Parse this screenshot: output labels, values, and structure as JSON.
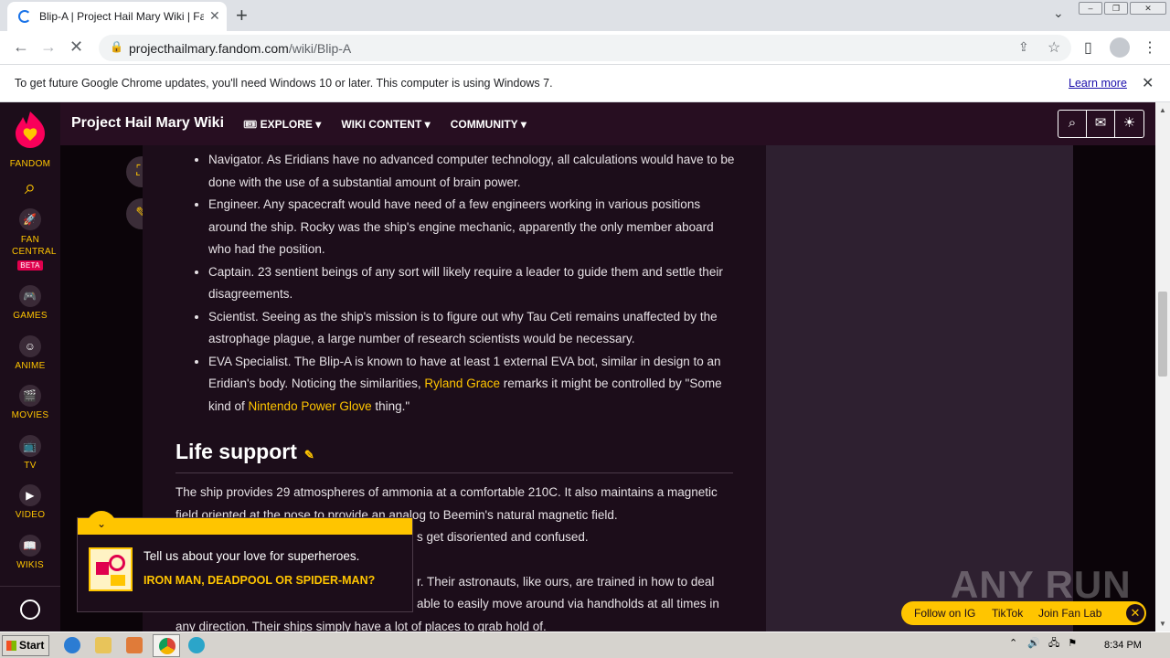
{
  "browser": {
    "tab_title": "Blip-A | Project Hail Mary Wiki | Fandom",
    "url_domain": "projecthailmary.fandom.com",
    "url_path": "/wiki/Blip-A"
  },
  "infobar": {
    "message": "To get future Google Chrome updates, you'll need Windows 10 or later. This computer is using Windows 7.",
    "learn_more": "Learn more"
  },
  "rail": {
    "fandom": "FANDOM",
    "fan_central": "FAN CENTRAL",
    "beta": "BETA",
    "games": "GAMES",
    "anime": "ANIME",
    "movies": "MOVIES",
    "tv": "TV",
    "video": "VIDEO",
    "wikis": "WIKIS"
  },
  "header": {
    "wiki_name": "Project Hail Mary Wiki",
    "nav": [
      "EXPLORE",
      "WIKI CONTENT",
      "COMMUNITY"
    ]
  },
  "article": {
    "bullets": [
      {
        "text": "Navigator. As Eridians have no advanced computer technology, all calculations would have to be done with the use of a substantial amount of brain power."
      },
      {
        "text": "Engineer. Any spacecraft would have need of a few engineers working in various positions around the ship. Rocky was the ship's engine mechanic, apparently the only member aboard who had the position."
      },
      {
        "text": "Captain. 23 sentient beings of any sort will likely require a leader to guide them and settle their disagreements."
      },
      {
        "text": "Scientist. Seeing as the ship's mission is to figure out why Tau Ceti remains unaffected by the astrophage plague, a large number of research scientists would be necessary."
      }
    ],
    "eva": {
      "pre": "EVA Specialist. The Blip-A is known to have at least 1 external EVA bot, similar in design to an Eridian's body. Noticing the similarities, ",
      "link1": "Ryland Grace",
      "mid": " remarks it might be controlled by \"Some kind of ",
      "link2": "Nintendo Power Glove",
      "post": " thing.\""
    },
    "section_title": "Life support",
    "para1": "The ship provides 29 atmospheres of ammonia at a comfortable 210C. It also maintains a magnetic field oriented at the nose to provide an analog to Beemin's natural magnetic field.",
    "para1_tail": "s get disoriented and confused.",
    "para2_frag1": "r. Their astronauts, like ours, are trained in how to deal",
    "para2_frag2": "able to easily move around via handholds at all times in",
    "para2_line3": "any direction. Their ships simply have a lot of places to grab hold of."
  },
  "promo": {
    "question": "Tell us about your love for superheroes.",
    "answer": "IRON MAN, DEADPOOL OR SPIDER-MAN?"
  },
  "follow": {
    "ig": "Follow on IG",
    "tiktok": "TikTok",
    "fanlab": "Join Fan Lab"
  },
  "watermark": "ANY RUN",
  "taskbar": {
    "start": "Start",
    "clock": "8:34 PM"
  },
  "colors": {
    "accent": "#ffc500",
    "page_bg": "#1c0d1a"
  }
}
